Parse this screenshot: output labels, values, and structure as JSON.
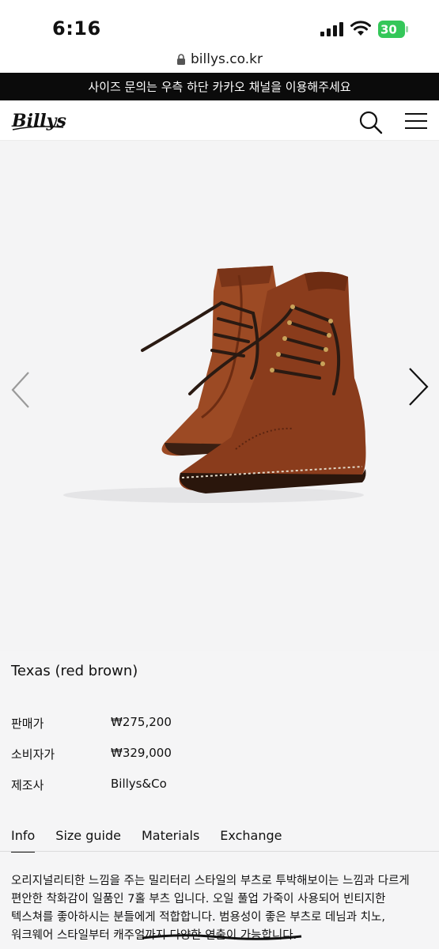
{
  "status_bar": {
    "time": "6:16",
    "battery_level": "30"
  },
  "browser": {
    "url": "billys.co.kr"
  },
  "banner": {
    "text": "사이즈 문의는 우측 하단 카카오 채널을 이용해주세요"
  },
  "header": {
    "logo_text": "Billys"
  },
  "product": {
    "title": "Texas (red brown)",
    "details": [
      {
        "label": "판매가",
        "value": "₩275,200"
      },
      {
        "label": "소비자가",
        "value": "₩329,000"
      },
      {
        "label": "제조사",
        "value": "Billys&Co"
      }
    ],
    "tabs": [
      "Info",
      "Size guide",
      "Materials",
      "Exchange"
    ],
    "active_tab": "Info",
    "description": "오리지널리티한 느낌을 주는 밀리터리 스타일의 부츠로 투박해보이는 느낌과 다르게 편안한 착화감이 일품인 7홀 부츠 입니다. 오일 풀업 가죽이 사용되어 빈티지한 텍스쳐를 좋아하시는 분들에게 적합합니다. 범용성이 좋은 부츠로 데님과 치노, 워크웨어 스타일부터 캐주얼까지 다양한 연출이 가능합니다."
  },
  "colors": {
    "banner_bg": "#0b0b0b",
    "leather": "#8a3c1c",
    "page_bg": "#f5f5f6"
  }
}
